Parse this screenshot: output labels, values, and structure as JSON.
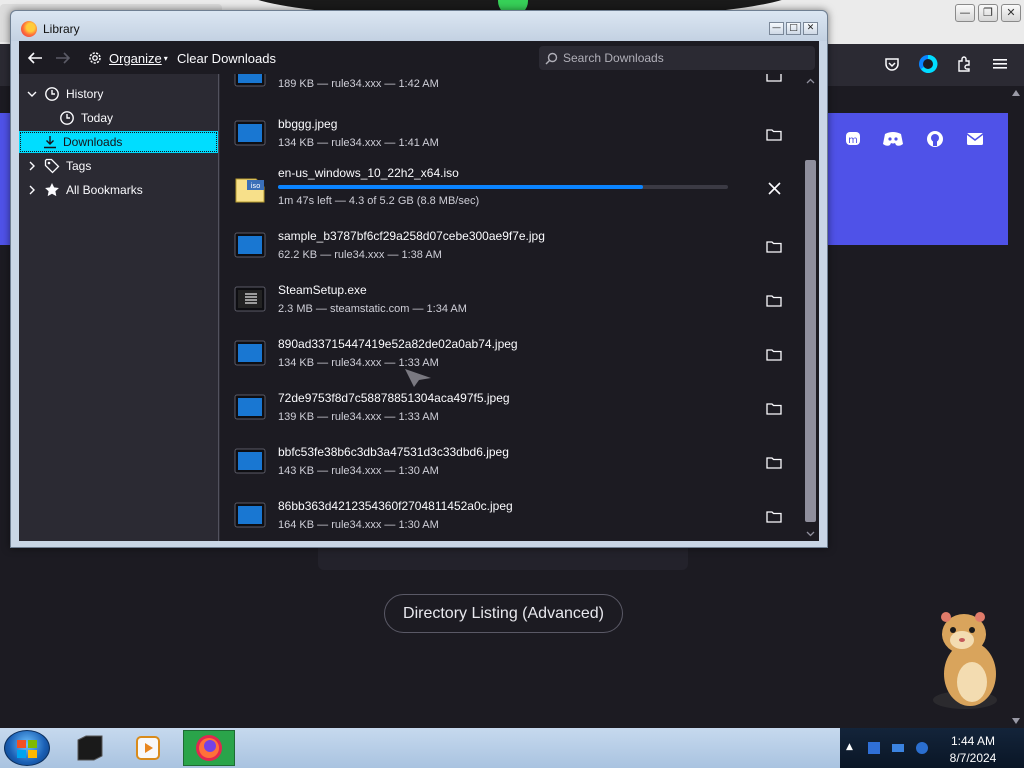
{
  "library": {
    "title": "Library",
    "toolbar": {
      "organize_label": "Organize",
      "clear_label": "Clear Downloads",
      "search_placeholder": "Search Downloads"
    },
    "sidebar": [
      {
        "label": "History"
      },
      {
        "label": "Today"
      },
      {
        "label": "Downloads"
      },
      {
        "label": "Tags"
      },
      {
        "label": "All Bookmarks"
      }
    ],
    "downloads": [
      {
        "name": "",
        "meta": "189 KB — rule34.xxx — 1:42 AM",
        "icon": "image-file-icon"
      },
      {
        "name": "bbggg.jpeg",
        "meta": "134 KB — rule34.xxx — 1:41 AM",
        "icon": "image-file-icon"
      },
      {
        "name": "en-us_windows_10_22h2_x64.iso",
        "meta": "1m 47s left — 4.3 of 5.2 GB (8.8 MB/sec)",
        "icon": "iso-file-icon",
        "progress": 0.81,
        "in_progress": true
      },
      {
        "name": "sample_b3787bf6cf29a258d07cebe300ae9f7e.jpg",
        "meta": "62.2 KB — rule34.xxx — 1:38 AM",
        "icon": "image-file-icon"
      },
      {
        "name": "SteamSetup.exe",
        "meta": "2.3 MB — steamstatic.com — 1:34 AM",
        "icon": "exe-file-icon"
      },
      {
        "name": "890ad33715447419e52a82de02a0ab74.jpeg",
        "meta": "134 KB — rule34.xxx — 1:33 AM",
        "icon": "image-file-icon"
      },
      {
        "name": "72de9753f8d7c58878851304aca497f5.jpeg",
        "meta": "139 KB — rule34.xxx — 1:33 AM",
        "icon": "image-file-icon"
      },
      {
        "name": "bbfc53fe38b6c3db3a47531d3c33dbd6.jpeg",
        "meta": "143 KB — rule34.xxx — 1:30 AM",
        "icon": "image-file-icon"
      },
      {
        "name": "86bb363d4212354360f2704811452a0c.jpeg",
        "meta": "164 KB — rule34.xxx — 1:30 AM",
        "icon": "image-file-icon"
      }
    ]
  },
  "page": {
    "directory_button": "Directory Listing (Advanced)"
  },
  "taskbar": {
    "time": "1:44 AM",
    "date": "8/7/2024"
  },
  "colors": {
    "accent": "#00ddff",
    "progress": "#0a84ff",
    "banner": "#4f52e8"
  }
}
